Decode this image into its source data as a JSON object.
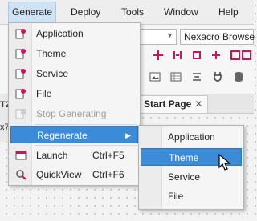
{
  "menubar": {
    "items": [
      {
        "label": "Generate"
      },
      {
        "label": "Deploy"
      },
      {
        "label": "Tools"
      },
      {
        "label": "Window"
      },
      {
        "label": "Help"
      }
    ]
  },
  "toolbar": {
    "browser_combo_value": "Nexacro Browse"
  },
  "left_strip": {
    "text1": "T2",
    "text2": "x7"
  },
  "tabs": {
    "start_page_label": "Start Page",
    "close_glyph": "✕"
  },
  "generate_menu": {
    "items": [
      {
        "label": "Application",
        "icon": "generate-application-icon",
        "enabled": true
      },
      {
        "label": "Theme",
        "icon": "generate-theme-icon",
        "enabled": true
      },
      {
        "label": "Service",
        "icon": "generate-service-icon",
        "enabled": true
      },
      {
        "label": "File",
        "icon": "generate-file-icon",
        "enabled": true
      },
      {
        "label": "Stop Generating",
        "icon": "stop-generating-icon",
        "enabled": false
      },
      {
        "label": "Regenerate",
        "submenu_arrow": "▶",
        "highlighted": true
      },
      {
        "label": "Launch",
        "shortcut": "Ctrl+F5",
        "icon": "launch-icon"
      },
      {
        "label": "QuickView",
        "shortcut": "Ctrl+F6",
        "icon": "quickview-icon"
      }
    ]
  },
  "regenerate_submenu": {
    "items": [
      {
        "label": "Application"
      },
      {
        "label": "Theme",
        "highlighted": true
      },
      {
        "label": "Service"
      },
      {
        "label": "File"
      }
    ]
  },
  "colors": {
    "highlight": "#3b8bd8",
    "menubar_active": "#cfe3f5"
  }
}
